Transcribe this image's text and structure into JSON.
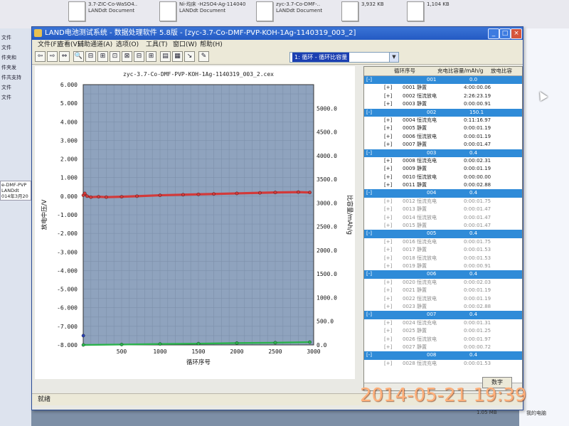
{
  "desktop": {
    "files": [
      {
        "name": "3.7-ZIC-Co-WaSO4..",
        "type": "LANDdt Document"
      },
      {
        "name": "Ni-均床 -H2SO4-Ag-114040",
        "type": "LANDdt Document"
      },
      {
        "name": "zyc-3.7-Co-DMF-..",
        "type": "LANDdt Document"
      },
      {
        "name": "3,932 KB",
        "type": ""
      },
      {
        "name": "1,104 KB",
        "type": ""
      }
    ],
    "left_items": [
      "文件",
      "文件",
      "件夹和",
      "件夹发",
      "件共支持",
      "文件",
      "文件"
    ],
    "left_box": [
      "e-DMF-PVP",
      "LANDdt",
      "014年3月20"
    ],
    "tray_size": "1.05 MB",
    "tray_label": "我的电脑"
  },
  "window": {
    "title": "LAND电池测试系统 - 数据处理软件 5.8版 - [zyc-3.7-Co-DMF-PVP-KOH-1Ag-1140319_003_2]",
    "controls": {
      "minimize": "_",
      "maximize": "□",
      "close": "×"
    }
  },
  "menu": [
    "文件(F)",
    "查看(V)",
    "辅助通道(A)",
    "选项(O)",
    "工具(T)",
    "窗口(W)",
    "帮助(H)"
  ],
  "toolbar": {
    "buttons": [
      "⇦",
      "⇨",
      "⇔",
      "🔍",
      "⊟",
      "⊞",
      "⊡",
      "⊠",
      "⊟",
      "⊞",
      "▤",
      "▦",
      "↘",
      "✎"
    ],
    "combo_value": "1: 循环 - 循环比容量"
  },
  "chart_data": {
    "type": "scatter",
    "title": "zyc-3.7-Co-DMF-PVP-KOH-1Ag-1140319_003_2.cex",
    "xlabel": "循环序号",
    "ylabel": "放电中压/V",
    "y2label": "比容量/mAh/g",
    "xlim": [
      0,
      3000
    ],
    "ylim": [
      -8.0,
      6.0
    ],
    "y2lim": [
      0,
      5500
    ],
    "x_ticks": [
      "500",
      "1000",
      "1500",
      "2000",
      "2500",
      "3000"
    ],
    "y_ticks": [
      "6.000",
      "5.000",
      "4.000",
      "3.000",
      "2.000",
      "1.000",
      "0.000",
      "-1.000",
      "-2.000",
      "-3.000",
      "-4.000",
      "-5.000",
      "-6.000",
      "-7.000",
      "-8.000"
    ],
    "y2_ticks": [
      "5000.0",
      "4500.0",
      "4000.0",
      "3500.0",
      "3000.0",
      "2500.0",
      "2000.0",
      "1500.0",
      "1000.0",
      "500.0",
      "0.0"
    ],
    "series": [
      {
        "color": "#d23a3a",
        "x": [
          1,
          20,
          50,
          100,
          200,
          300,
          500,
          700,
          1000,
          1300,
          1500,
          1700,
          2000,
          2300,
          2500,
          2800,
          2950
        ],
        "y": [
          0.05,
          0.15,
          0.0,
          -0.05,
          -0.03,
          -0.05,
          -0.03,
          0.0,
          0.05,
          0.08,
          0.1,
          0.12,
          0.15,
          0.18,
          0.2,
          0.22,
          0.2
        ]
      },
      {
        "color": "#2bb24c",
        "x": [
          1,
          500,
          1000,
          1500,
          2000,
          2500,
          2950
        ],
        "y": [
          -8.0,
          -7.98,
          -7.95,
          -7.93,
          -7.9,
          -7.88,
          -7.85
        ]
      },
      {
        "color": "#2a3fb0",
        "x": [
          1
        ],
        "y": [
          -7.5
        ]
      }
    ],
    "background": "#8fa3be",
    "grid": true
  },
  "panel": {
    "headers": [
      "循环序号",
      "充电比容量/mAh/g",
      "放电比容"
    ],
    "groups": [
      {
        "id": "001",
        "value": "0.0",
        "rows": [
          [
            "0001",
            "静置",
            "4:00:00.06"
          ],
          [
            "0002",
            "恒流放电",
            "2:26:23.19"
          ],
          [
            "0003",
            "静置",
            "0:00:00.91"
          ]
        ]
      },
      {
        "id": "002",
        "value": "150.1",
        "rows": [
          [
            "0004",
            "恒流充电",
            "0:11:16.97"
          ],
          [
            "0005",
            "静置",
            "0:00:01.19"
          ],
          [
            "0006",
            "恒流放电",
            "0:00:01.19"
          ],
          [
            "0007",
            "静置",
            "0:00:01.47"
          ]
        ]
      },
      {
        "id": "003",
        "value": "0.4",
        "rows": [
          [
            "0008",
            "恒流充电",
            "0:00:02.31"
          ],
          [
            "0009",
            "静置",
            "0:00:01.19"
          ],
          [
            "0010",
            "恒流放电",
            "0:00:00.00"
          ],
          [
            "0011",
            "静置",
            "0:00:02.88"
          ]
        ]
      },
      {
        "id": "004",
        "value": "0.4",
        "rows": [
          [
            "0012",
            "恒流充电",
            "0:00:01.75"
          ],
          [
            "0013",
            "静置",
            "0:00:01.47"
          ],
          [
            "0014",
            "恒流放电",
            "0:00:01.47"
          ],
          [
            "0015",
            "静置",
            "0:00:01.47"
          ]
        ]
      },
      {
        "id": "005",
        "value": "0.4",
        "rows": [
          [
            "0016",
            "恒流充电",
            "0:00:01.75"
          ],
          [
            "0017",
            "静置",
            "0:00:01.53"
          ],
          [
            "0018",
            "恒流放电",
            "0:00:01.53"
          ],
          [
            "0019",
            "静置",
            "0:00:00.91"
          ]
        ]
      },
      {
        "id": "006",
        "value": "0.4",
        "rows": [
          [
            "0020",
            "恒流充电",
            "0:00:02.03"
          ],
          [
            "0021",
            "静置",
            "0:00:01.19"
          ],
          [
            "0022",
            "恒流放电",
            "0:00:01.19"
          ],
          [
            "0023",
            "静置",
            "0:00:02.88"
          ]
        ]
      },
      {
        "id": "007",
        "value": "0.4",
        "rows": [
          [
            "0024",
            "恒流充电",
            "0:00:01.31"
          ],
          [
            "0025",
            "静置",
            "0:00:01.25"
          ],
          [
            "0026",
            "恒流放电",
            "0:00:01.97"
          ],
          [
            "0027",
            "静置",
            "0:00:00.72"
          ]
        ]
      },
      {
        "id": "008",
        "value": "0.4",
        "rows": [
          [
            "0028",
            "恒流充电",
            "0:00:01.53"
          ]
        ]
      }
    ],
    "button": "数字"
  },
  "status_text": "就绪",
  "timestamp": "2014-05-21 19:39"
}
